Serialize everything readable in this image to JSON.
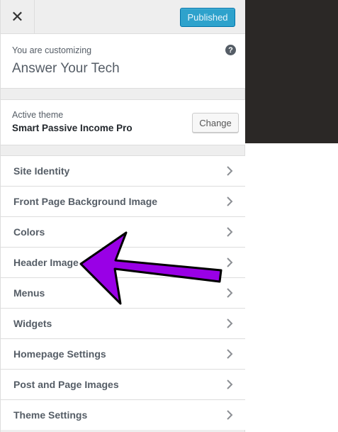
{
  "header": {
    "close_icon": "close-icon",
    "close_glyph": "✕",
    "publish_label": "Published"
  },
  "customize_info": {
    "label": "You are customizing",
    "site_title": "Answer Your Tech",
    "help_icon": "help-icon",
    "help_glyph": "?"
  },
  "theme": {
    "label": "Active theme",
    "name": "Smart Passive Income Pro",
    "change_label": "Change"
  },
  "sections": [
    {
      "label": "Site Identity"
    },
    {
      "label": "Front Page Background Image"
    },
    {
      "label": "Colors"
    },
    {
      "label": "Header Image"
    },
    {
      "label": "Menus"
    },
    {
      "label": "Widgets"
    },
    {
      "label": "Homepage Settings"
    },
    {
      "label": "Post and Page Images"
    },
    {
      "label": "Theme Settings"
    }
  ],
  "annotation": {
    "arrow_icon": "pointer-arrow",
    "color": "#9900e6"
  },
  "colors": {
    "publish_bg": "#2ea2cc",
    "preview_dark": "#2b2826"
  }
}
